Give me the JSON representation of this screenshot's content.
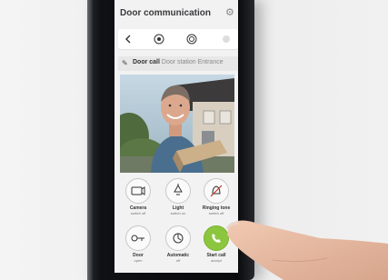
{
  "app": {
    "title": "Door communication"
  },
  "status": {
    "label": "Door call",
    "detail": "Door station Entrance"
  },
  "nav": {
    "buttons": [
      "back",
      "mute",
      "camera-switch",
      "more"
    ]
  },
  "controls": [
    {
      "label": "Camera",
      "sub": "switch off",
      "icon": "camera-icon"
    },
    {
      "label": "Light",
      "sub": "switch on",
      "icon": "light-icon"
    },
    {
      "label": "Ringing tone",
      "sub": "switch off",
      "icon": "bell-off-icon"
    },
    {
      "label": "Door",
      "sub": "open",
      "icon": "key-icon"
    },
    {
      "label": "Automatic",
      "sub": "off",
      "icon": "automatic-icon"
    },
    {
      "label": "Start call",
      "sub": "accept",
      "icon": "phone-icon"
    }
  ],
  "colors": {
    "accept_green": "#8cc63f",
    "device_black": "#0a0b0d",
    "screen_bg": "#f2f2f3"
  }
}
